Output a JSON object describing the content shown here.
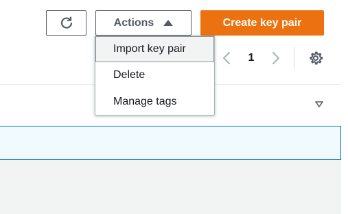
{
  "toolbar": {
    "refresh_icon": "refresh-icon",
    "actions_label": "Actions",
    "actions_icon": "caret-up-icon",
    "create_label": "Create key pair",
    "create_color": "#ec7211"
  },
  "actions_menu": {
    "items": [
      {
        "label": "Import key pair",
        "hovered": true
      },
      {
        "label": "Delete",
        "hovered": false
      },
      {
        "label": "Manage tags",
        "hovered": false
      }
    ]
  },
  "pagination": {
    "prev_icon": "chevron-left-icon",
    "current_page": "1",
    "next_icon": "chevron-right-icon",
    "settings_icon": "gear-icon"
  },
  "table": {
    "sort_icon": "sort-descending-icon",
    "selected_row_color": "#f1faff",
    "selected_border_color": "#0073bb"
  }
}
